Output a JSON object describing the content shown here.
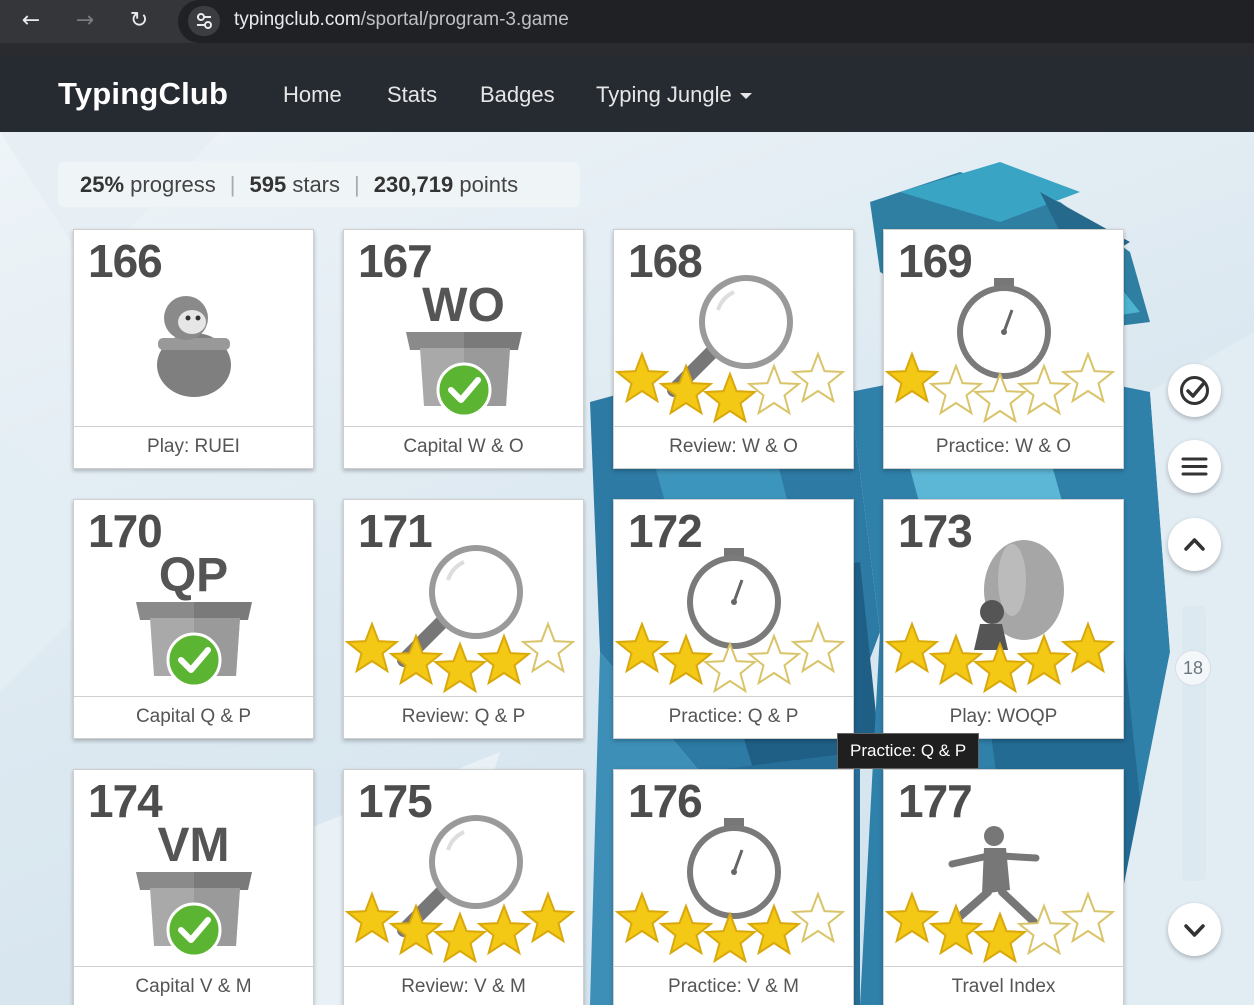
{
  "browser": {
    "url_host": "typingclub.com",
    "url_path": "/sportal/program-3.game"
  },
  "nav": {
    "logo": "TypingClub",
    "links": [
      "Home",
      "Stats",
      "Badges",
      "Typing Jungle"
    ]
  },
  "summary": {
    "progress_value": "25%",
    "progress_word": "progress",
    "stars_value": "595",
    "stars_word": "stars",
    "points_value": "230,719",
    "points_word": "points"
  },
  "lessons": [
    {
      "number": "166",
      "title": "Play: RUEI",
      "letters": "",
      "kind": "play-character",
      "stars": null,
      "completed": false
    },
    {
      "number": "167",
      "title": "Capital W & O",
      "letters": "WO",
      "kind": "box",
      "stars": null,
      "completed": true
    },
    {
      "number": "168",
      "title": "Review: W & O",
      "letters": "",
      "kind": "magnifier",
      "stars": 3,
      "completed": false
    },
    {
      "number": "169",
      "title": "Practice: W & O",
      "letters": "",
      "kind": "stopwatch",
      "stars": 1,
      "completed": false
    },
    {
      "number": "170",
      "title": "Capital Q & P",
      "letters": "QP",
      "kind": "box",
      "stars": null,
      "completed": true
    },
    {
      "number": "171",
      "title": "Review: Q & P",
      "letters": "",
      "kind": "magnifier",
      "stars": 4,
      "completed": false
    },
    {
      "number": "172",
      "title": "Practice: Q & P",
      "letters": "",
      "kind": "stopwatch",
      "stars": 2,
      "completed": false
    },
    {
      "number": "173",
      "title": "Play: WOQP",
      "letters": "",
      "kind": "balloon",
      "stars": 5,
      "completed": false
    },
    {
      "number": "174",
      "title": "Capital V & M",
      "letters": "VM",
      "kind": "box",
      "stars": null,
      "completed": true
    },
    {
      "number": "175",
      "title": "Review: V & M",
      "letters": "",
      "kind": "magnifier",
      "stars": 5,
      "completed": false
    },
    {
      "number": "176",
      "title": "Practice: V & M",
      "letters": "",
      "kind": "stopwatch",
      "stars": 4,
      "completed": false
    },
    {
      "number": "177",
      "title": "Travel Index",
      "letters": "",
      "kind": "runner",
      "stars": 3,
      "completed": false
    }
  ],
  "tooltip": "Practice: Q & P",
  "scroll": {
    "level": "18"
  },
  "side_buttons": [
    "check-circle-icon",
    "menu-icon",
    "chevron-up-icon",
    "chevron-down-icon"
  ],
  "colors": {
    "nav_bg": "#262a31",
    "star_gold": "#f4c916",
    "check_green": "#5bb533"
  }
}
